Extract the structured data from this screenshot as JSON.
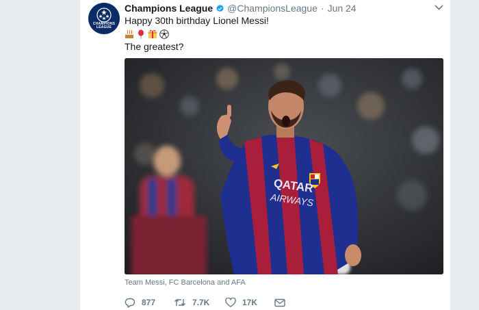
{
  "tweet": {
    "author_name": "Champions League",
    "author_handle": "@ChampionsLeague",
    "separator": "·",
    "timestamp": "Jun 24",
    "avatar_text": "CHAMPIONS LEAGUE",
    "line1": "Happy 30th birthday Lionel Messi!",
    "emojis": [
      "birthday-cake",
      "balloon",
      "gift",
      "soccer-ball"
    ],
    "line2": "The greatest?",
    "photo_credit": "Team Messi, FC Barcelona and AFA",
    "jersey_sponsor_line1": "QATAR",
    "jersey_sponsor_line2": "AIRWAYS",
    "counts": {
      "replies": "877",
      "retweets": "7.7K",
      "likes": "17K"
    }
  },
  "colors": {
    "background": "#e6ecf0",
    "card": "#ffffff",
    "verified": "#1da1f2",
    "muted": "#657786",
    "text": "#14171a"
  }
}
